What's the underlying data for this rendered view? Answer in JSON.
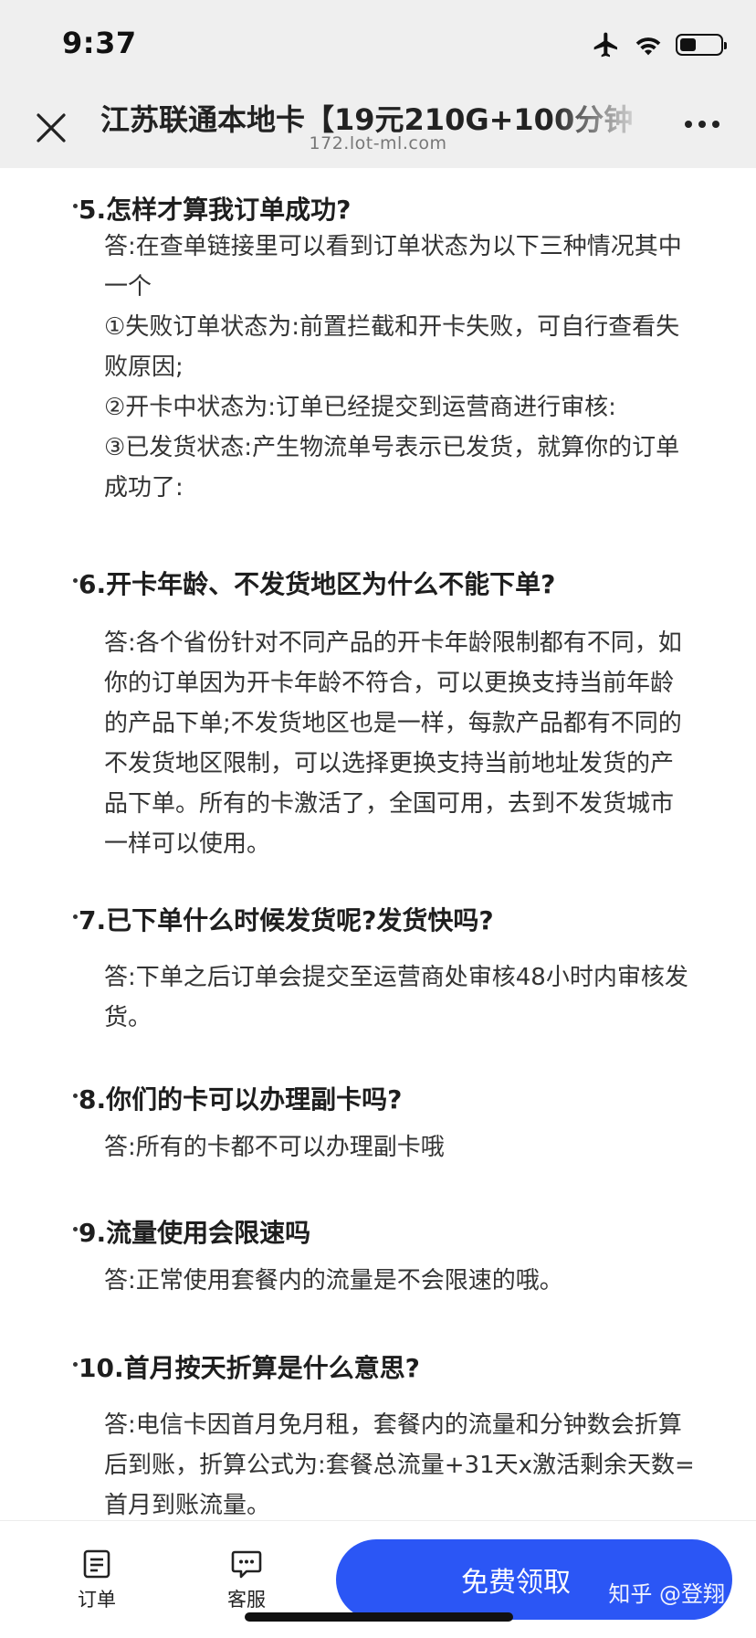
{
  "status_bar": {
    "time": "9:37",
    "icons": [
      "airplane-icon",
      "wifi-icon",
      "battery-icon"
    ],
    "battery_level": 0.4
  },
  "header": {
    "title": "江苏联通本地卡【19元210G+100分钟",
    "url": "172.lot-ml.com",
    "close_icon": "close-icon",
    "more_icon": "more-icon"
  },
  "faq": [
    {
      "question": "5.怎样才算我订单成功?",
      "answer_lines": [
        "答:在查单链接里可以看到订单状态为以下三种情况其中",
        "一个",
        "①失败订单状态为:前置拦截和开卡失败，可自行查看失",
        "败原因;",
        "②开卡中状态为:订单已经提交到运营商进行审核:",
        "③已发货状态:产生物流单号表示已发货，就算你的订单",
        "成功了:"
      ]
    },
    {
      "question": "6.开卡年龄、不发货地区为什么不能下单?",
      "answer_lines": [
        "答:各个省份针对不同产品的开卡年龄限制都有不同，如",
        "你的订单因为开卡年龄不符合，可以更换支持当前年龄",
        "的产品下单;不发货地区也是一样，每款产品都有不同的",
        "不发货地区限制，可以选择更换支持当前地址发货的产",
        "品下单。所有的卡激活了，全国可用，去到不发货城市",
        "一样可以使用。"
      ]
    },
    {
      "question": "7.已下单什么时候发货呢?发货快吗?",
      "answer_lines": [
        "答:下单之后订单会提交至运营商处审核48小时内审核发",
        "货。"
      ]
    },
    {
      "question": "8.你们的卡可以办理副卡吗?",
      "answer_lines": [
        "答:所有的卡都不可以办理副卡哦"
      ]
    },
    {
      "question": "9.流量使用会限速吗",
      "answer_lines": [
        "答:正常使用套餐内的流量是不会限速的哦。"
      ]
    },
    {
      "question": "10.首月按天折算是什么意思?",
      "answer_lines": [
        "答:电信卡因首月免月租，套餐内的流量和分钟数会折算",
        "后到账，折算公式为:套餐总流量+31天x激活剩余天数=",
        "首月到账流量。"
      ]
    }
  ],
  "bottom_bar": {
    "tabs": [
      {
        "label": "订单",
        "icon": "order-list-icon"
      },
      {
        "label": "客服",
        "icon": "chat-bubble-icon"
      }
    ],
    "cta_label": "免费领取",
    "watermark": "知乎 @登翔",
    "cta_color": "#2b56f5"
  }
}
